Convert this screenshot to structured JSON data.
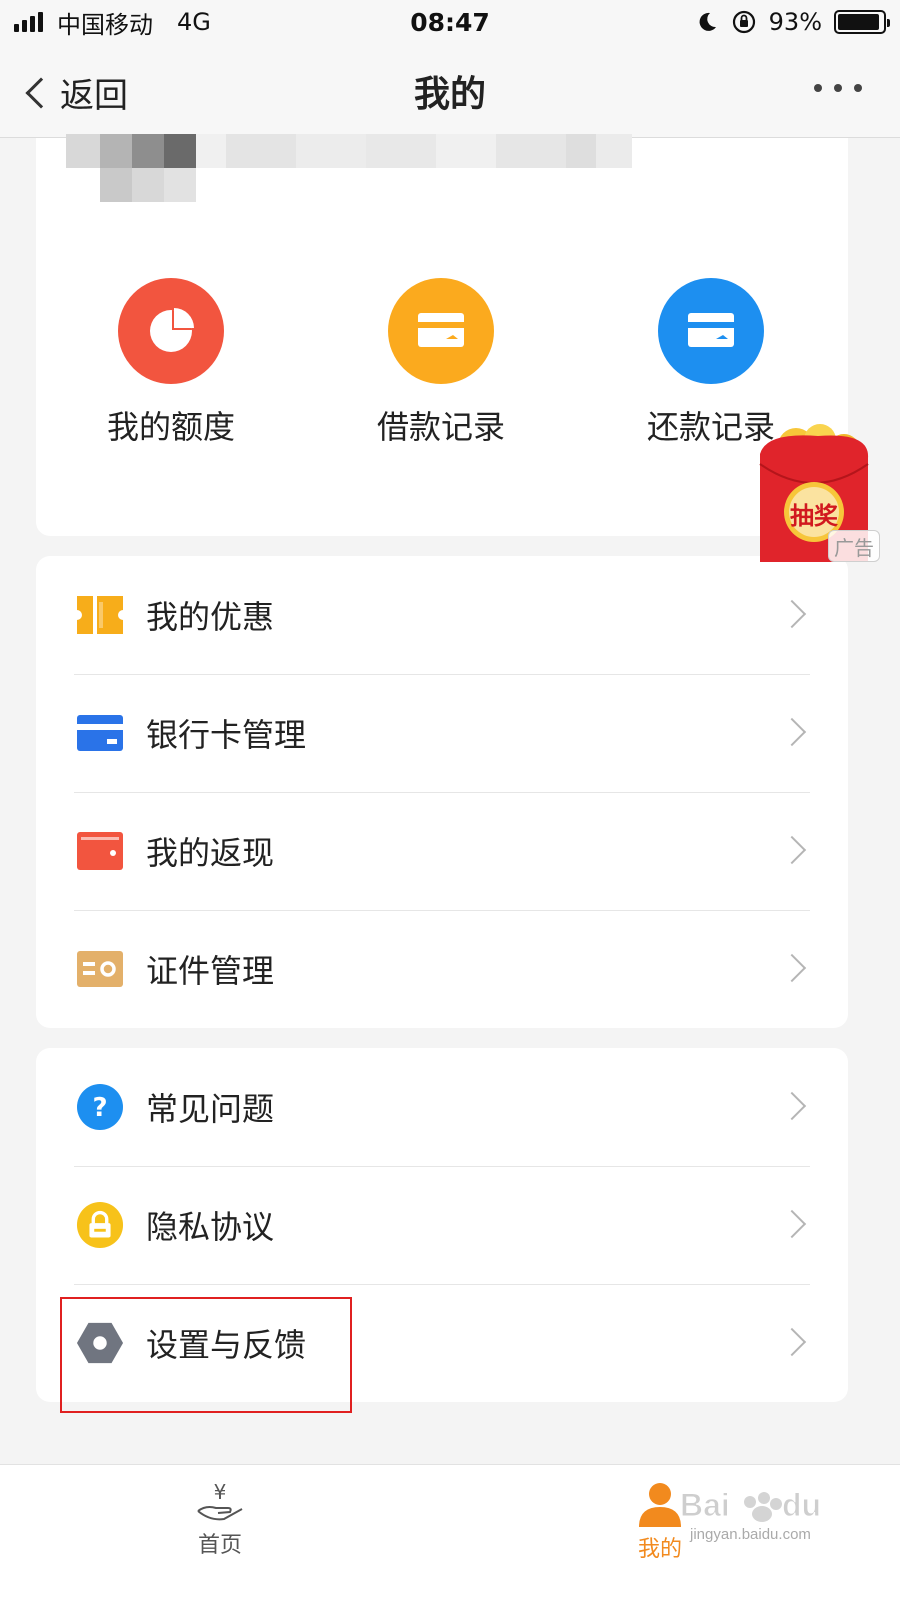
{
  "status_bar": {
    "carrier": "中国移动",
    "network": "4G",
    "time": "08:47",
    "battery_percent": "93%",
    "battery_level": 0.93,
    "icons": [
      "signal-icon",
      "moon-icon",
      "rotation-lock-icon",
      "battery-icon"
    ]
  },
  "navbar": {
    "back_label": "返回",
    "title": "我的",
    "more_icon": "more-dots-icon"
  },
  "quick_actions": [
    {
      "label": "我的额度",
      "icon": "pie-chart-icon",
      "color": "#f2553f"
    },
    {
      "label": "借款记录",
      "icon": "card-icon",
      "color": "#fbaa1e"
    },
    {
      "label": "还款记录",
      "icon": "card-icon",
      "color": "#1d8ff0"
    }
  ],
  "menu_group_1": [
    {
      "label": "我的优惠",
      "icon": "coupon-icon",
      "color": "#f7ad1a"
    },
    {
      "label": "银行卡管理",
      "icon": "bank-card-icon",
      "color": "#2a73e8"
    },
    {
      "label": "我的返现",
      "icon": "wallet-icon",
      "color": "#f2553f"
    },
    {
      "label": "证件管理",
      "icon": "id-card-icon",
      "color": "#e3b06a"
    }
  ],
  "menu_group_2": [
    {
      "label": "常见问题",
      "icon": "question-icon",
      "color": "#1d8ff0"
    },
    {
      "label": "隐私协议",
      "icon": "lock-icon",
      "color": "#f7c21a"
    },
    {
      "label": "设置与反馈",
      "icon": "settings-icon",
      "color": "#707580"
    }
  ],
  "lottery_ad": {
    "label": "抽奖",
    "tag": "广告"
  },
  "tab_bar": {
    "tabs": [
      {
        "label": "首页",
        "icon": "home-yen-icon",
        "active": false
      },
      {
        "label": "我的",
        "icon": "user-icon",
        "active": true
      }
    ],
    "active_color": "#f28a1e"
  },
  "watermark": {
    "text": "jingyan.baidu.com"
  }
}
